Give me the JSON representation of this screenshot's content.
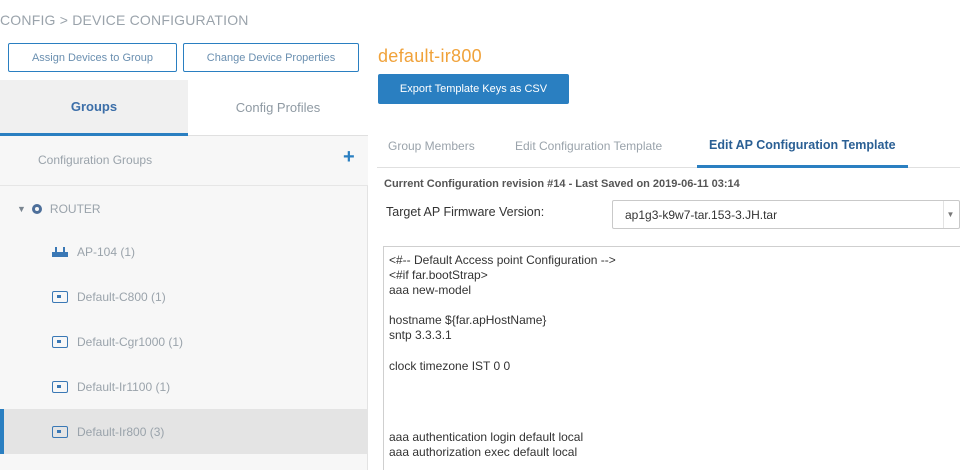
{
  "breadcrumb": "CONFIG > DEVICE CONFIGURATION",
  "toolbar": {
    "assign_label": "Assign Devices to Group",
    "change_label": "Change Device Properties"
  },
  "left": {
    "tabs": [
      {
        "label": "Groups",
        "active": true
      },
      {
        "label": "Config Profiles",
        "active": false
      }
    ],
    "config_groups_label": "Configuration Groups",
    "root": {
      "label": "ROUTER"
    },
    "items": [
      {
        "label": "AP-104 (1)",
        "icon": "access-point-icon"
      },
      {
        "label": "Default-C800 (1)",
        "icon": "device-icon"
      },
      {
        "label": "Default-Cgr1000 (1)",
        "icon": "device-icon"
      },
      {
        "label": "Default-Ir1100 (1)",
        "icon": "device-icon"
      },
      {
        "label": "Default-Ir800 (3)",
        "icon": "device-icon",
        "selected": true
      }
    ]
  },
  "right": {
    "title": "default-ir800",
    "export_label": "Export Template Keys as CSV",
    "tabs": [
      {
        "label": "Group Members",
        "active": false
      },
      {
        "label": "Edit Configuration Template",
        "active": false
      },
      {
        "label": "Edit AP Configuration Template",
        "active": true
      }
    ],
    "revision": "Current Configuration revision #14 - Last Saved on 2019-06-11 03:14",
    "firmware_label": "Target AP Firmware Version:",
    "firmware_value": "ap1g3-k9w7-tar.153-3.JH.tar",
    "code_lines": [
      "<#-- Default Access point Configuration -->",
      "<#if far.bootStrap>",
      "aaa new-model",
      "",
      "hostname ${far.apHostName}",
      "sntp 3.3.3.1",
      "",
      "clock timezone IST 0 0",
      "",
      "",
      "",
      "aaa authentication login default local",
      "aaa authorization exec default local"
    ]
  },
  "colors": {
    "accent": "#2a7fc1",
    "title_orange": "#f0a23a",
    "selected_row": "#e4e4e4"
  }
}
